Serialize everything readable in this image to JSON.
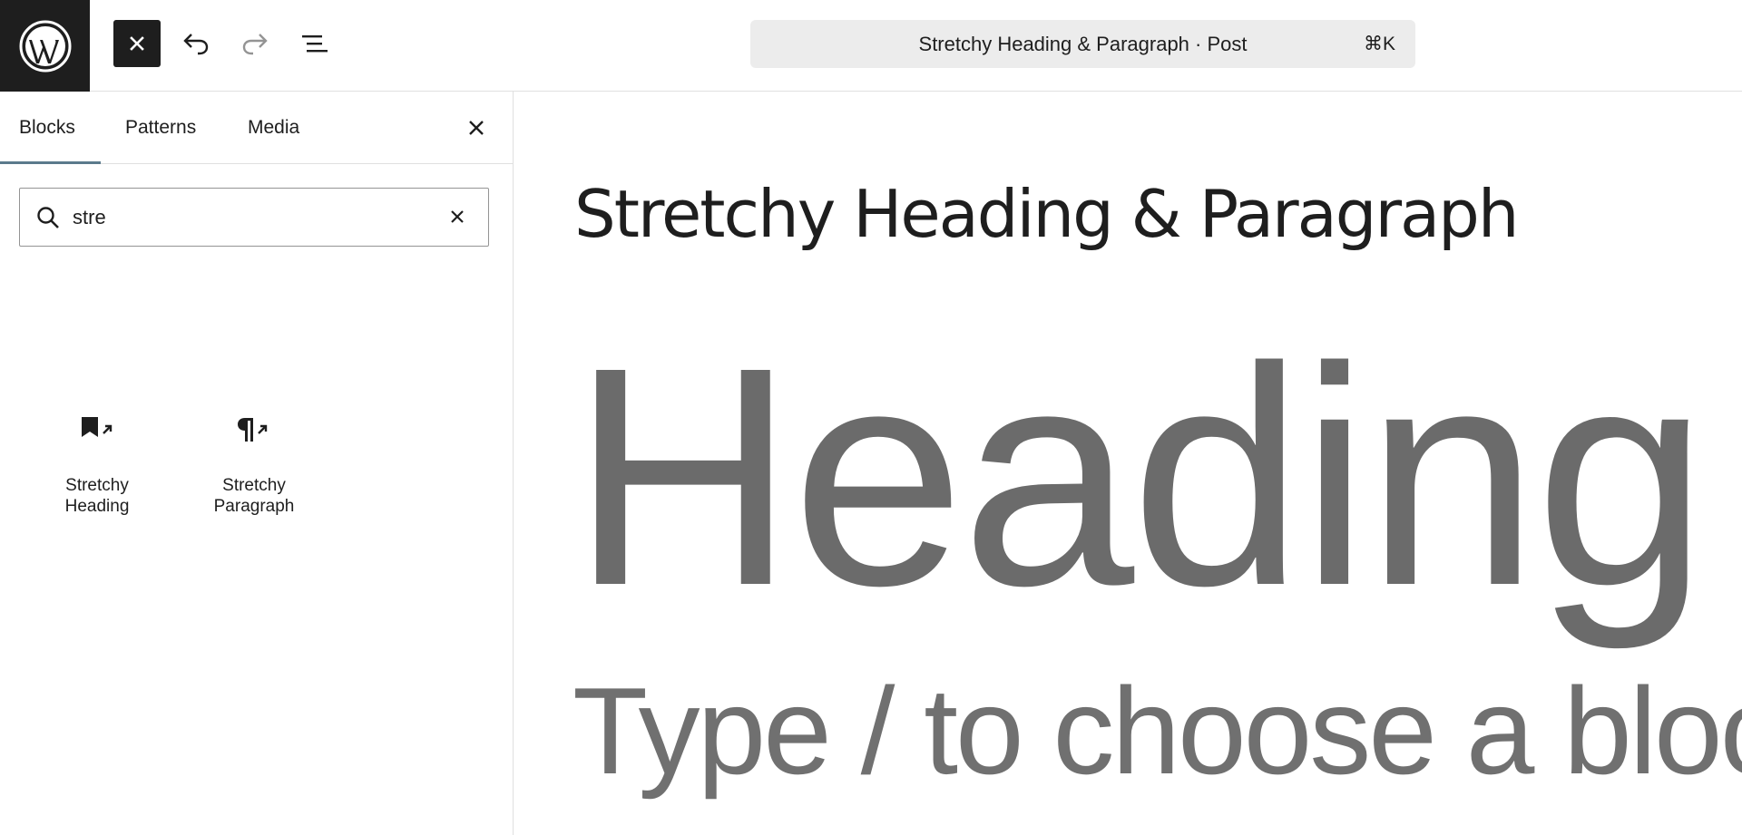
{
  "toolbar": {
    "logo_icon": "wordpress-logo-icon",
    "inserter_close_icon": "close-icon",
    "undo_icon": "undo-icon",
    "redo_icon": "redo-icon",
    "list_view_icon": "list-view-icon",
    "document_title": "Stretchy Heading & Paragraph · Post",
    "shortcut": "⌘K"
  },
  "inserter": {
    "tabs": [
      {
        "label": "Blocks",
        "active": true
      },
      {
        "label": "Patterns",
        "active": false
      },
      {
        "label": "Media",
        "active": false
      }
    ],
    "close_icon": "close-icon",
    "search": {
      "value": "stre",
      "icon": "search-icon",
      "clear_icon": "close-icon"
    },
    "results": [
      {
        "label": "Stretchy Heading",
        "icon": "bookmark-arrow-icon"
      },
      {
        "label": "Stretchy Paragraph",
        "icon": "pilcrow-arrow-icon"
      }
    ]
  },
  "editor": {
    "post_title": "Stretchy Heading & Paragraph",
    "heading_block_text": "Heading",
    "paragraph_placeholder": "Type / to choose a block"
  },
  "colors": {
    "dark": "#1e1e1e",
    "tab_indicator": "#5b7a8c",
    "command_bar_bg": "#ececec",
    "heading_gray": "#6b6b6b",
    "border": "#e0e0e0"
  }
}
